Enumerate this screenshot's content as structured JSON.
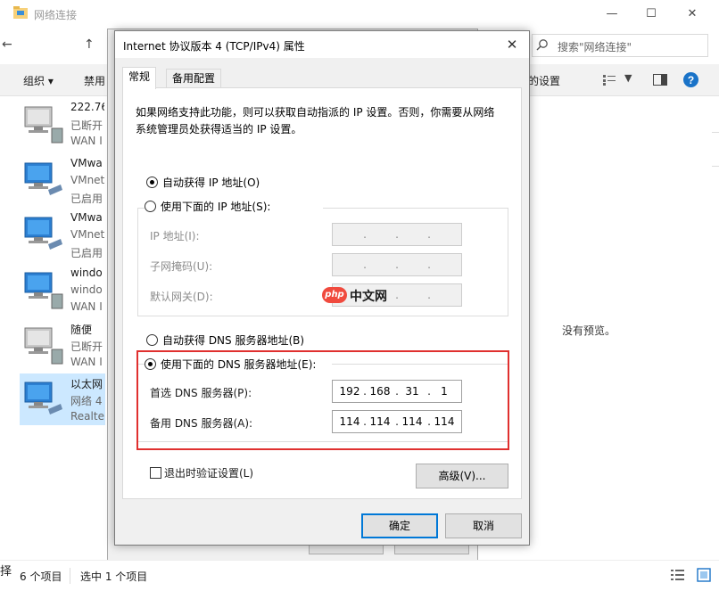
{
  "explorer": {
    "title": "网络连接",
    "search_placeholder": "搜索\"网络连接\"",
    "commands": {
      "organize": "组织",
      "disable": "禁用",
      "settings": "的设置"
    },
    "connections": [
      {
        "line1": "222.76",
        "line2": "已断开",
        "line3": "WAN I"
      },
      {
        "line1": "VMwa",
        "line2": "VMnet",
        "line3": "已启用"
      },
      {
        "line1": "VMwa",
        "line2": "VMnet",
        "line3": "已启用"
      },
      {
        "line1": "windo",
        "line2": "windo",
        "line3": "WAN I"
      },
      {
        "line1": "随便",
        "line2": "已断开",
        "line3": "WAN I"
      },
      {
        "line1": "以太网",
        "line2": "网络 4",
        "line3": "Realte"
      }
    ],
    "preview_text": "没有预览。",
    "status": {
      "item_count": "6 个项目",
      "selected": "选中 1 个项目"
    },
    "left_glyph": "择"
  },
  "dialog": {
    "title": "Internet 协议版本 4 (TCP/IPv4) 属性",
    "tabs": [
      {
        "label": "常规"
      },
      {
        "label": "备用配置"
      }
    ],
    "description": "如果网络支持此功能，则可以获取自动指派的 IP 设置。否则，你需要从网络系统管理员处获得适当的 IP 设置。",
    "ip": {
      "auto_label": "自动获得 IP 地址(O)",
      "manual_label": "使用下面的 IP 地址(S):",
      "address_label": "IP 地址(I):",
      "subnet_label": "子网掩码(U):",
      "gateway_label": "默认网关(D):"
    },
    "dns": {
      "auto_label": "自动获得 DNS 服务器地址(B)",
      "manual_label": "使用下面的 DNS 服务器地址(E):",
      "preferred_label": "首选 DNS 服务器(P):",
      "alternate_label": "备用 DNS 服务器(A):",
      "preferred": [
        "192",
        "168",
        "31",
        "1"
      ],
      "alternate": [
        "114",
        "114",
        "114",
        "114"
      ]
    },
    "validate_label": "退出时验证设置(L)",
    "advanced_button": "高级(V)...",
    "ok_button": "确定",
    "cancel_button": "取消"
  },
  "watermark": {
    "badge": "php",
    "text": "中文网"
  }
}
